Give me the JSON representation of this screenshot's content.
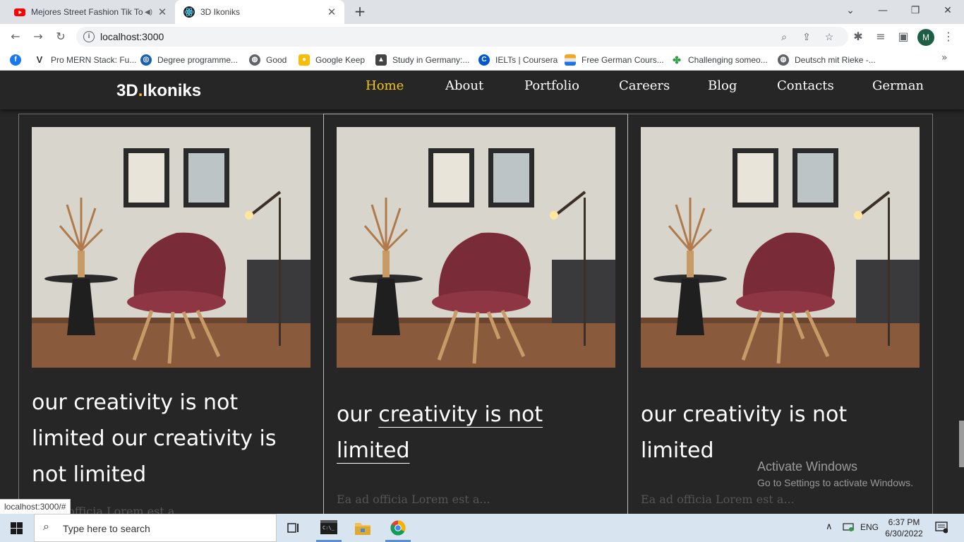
{
  "browser": {
    "tabs": [
      {
        "title": "Mejores Street Fashion Tik To",
        "active": false,
        "audio": true
      },
      {
        "title": "3D Ikoniks",
        "active": true
      }
    ],
    "url": "localhost:3000",
    "profile_initial": "M",
    "bookmarks": [
      {
        "label": "Pro MERN Stack: Fu...",
        "icon": "v-icon"
      },
      {
        "label": "Degree programme...",
        "icon": "globe-blue-icon"
      },
      {
        "label": "Good",
        "icon": "globe-icon"
      },
      {
        "label": "Google Keep",
        "icon": "keep-icon"
      },
      {
        "label": "Study in Germany:...",
        "icon": "study-icon"
      },
      {
        "label": "IELTs | Coursera",
        "icon": "coursera-icon"
      },
      {
        "label": "Free German Cours...",
        "icon": "flag-icon"
      },
      {
        "label": "Challenging someo...",
        "icon": "clover-icon"
      },
      {
        "label": "Deutsch mit Rieke -...",
        "icon": "globe-icon"
      }
    ]
  },
  "site": {
    "logo_main": "3D",
    "logo_dot": ".",
    "logo_rest": "Ikoniks",
    "nav": {
      "home": "Home",
      "about": "About",
      "portfolio": "Portfolio",
      "careers": "Careers",
      "blog": "Blog",
      "contacts": "Contacts",
      "german": "German"
    },
    "active_nav": "Home",
    "cards": [
      {
        "title_l1": "our creativity is not",
        "title_l2": "limited our creativity is",
        "title_l3": "not limited",
        "excerpt": "Ea ad officia Lorem est a..."
      },
      {
        "title_a": "our ",
        "title_b": "creativity is not",
        "title_c": "limited",
        "excerpt": "Ea ad officia Lorem est a..."
      },
      {
        "title_l1": "our creativity is not",
        "title_l2": "limited",
        "excerpt": "Ea ad officia Lorem est a..."
      }
    ]
  },
  "status_url": "localhost:3000/#",
  "watermark": {
    "line1": "Activate Windows",
    "line2": "Go to Settings to activate Windows."
  },
  "taskbar": {
    "search_placeholder": "Type here to search",
    "language": "ENG",
    "time": "6:37 PM",
    "date": "6/30/2022"
  },
  "colors": {
    "accent": "#f5c518",
    "page_bg": "#262626"
  }
}
